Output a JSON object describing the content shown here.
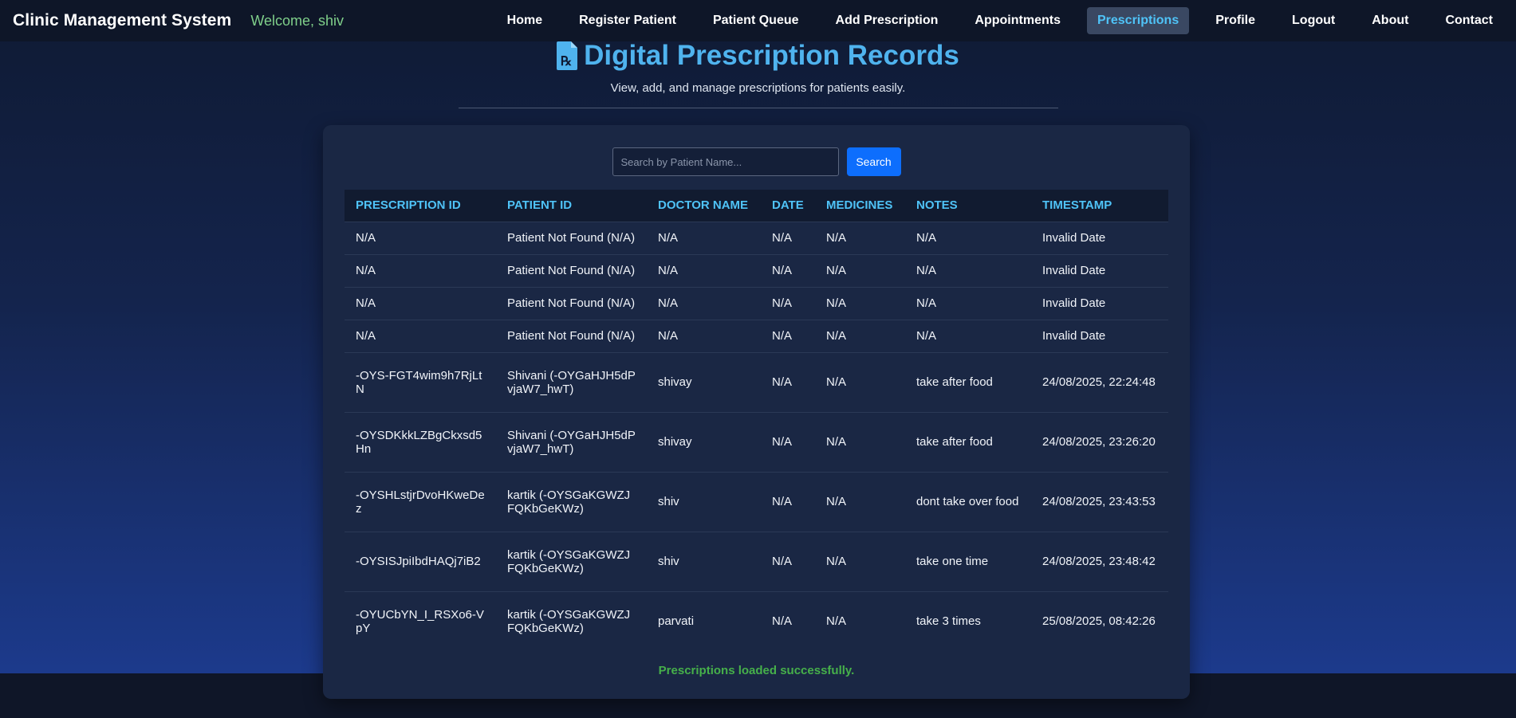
{
  "nav": {
    "brand": "Clinic Management System",
    "welcome": "Welcome, shiv",
    "links": [
      {
        "label": "Home"
      },
      {
        "label": "Register Patient"
      },
      {
        "label": "Patient Queue"
      },
      {
        "label": "Add Prescription"
      },
      {
        "label": "Appointments"
      },
      {
        "label": "Prescriptions",
        "active": true
      },
      {
        "label": "Profile"
      },
      {
        "label": "Logout"
      },
      {
        "label": "About"
      },
      {
        "label": "Contact"
      }
    ]
  },
  "header": {
    "icon": "prescription-icon",
    "title": "Digital Prescription Records",
    "subtitle": "View, add, and manage prescriptions for patients easily."
  },
  "search": {
    "placeholder": "Search by Patient Name...",
    "value": "",
    "button_label": "Search"
  },
  "table": {
    "headers": [
      "PRESCRIPTION ID",
      "PATIENT ID",
      "DOCTOR NAME",
      "DATE",
      "MEDICINES",
      "NOTES",
      "TIMESTAMP"
    ],
    "rows": [
      [
        "N/A",
        "Patient Not Found (N/A)",
        "N/A",
        "N/A",
        "N/A",
        "N/A",
        "Invalid Date"
      ],
      [
        "N/A",
        "Patient Not Found (N/A)",
        "N/A",
        "N/A",
        "N/A",
        "N/A",
        "Invalid Date"
      ],
      [
        "N/A",
        "Patient Not Found (N/A)",
        "N/A",
        "N/A",
        "N/A",
        "N/A",
        "Invalid Date"
      ],
      [
        "N/A",
        "Patient Not Found (N/A)",
        "N/A",
        "N/A",
        "N/A",
        "N/A",
        "Invalid Date"
      ],
      [
        "-OYS-FGT4wim9h7RjLtN",
        "Shivani (-OYGaHJH5dPvjaW7_hwT)",
        "shivay",
        "N/A",
        "N/A",
        "take after food",
        "24/08/2025, 22:24:48"
      ],
      [
        "-OYSDKkkLZBgCkxsd5Hn",
        "Shivani (-OYGaHJH5dPvjaW7_hwT)",
        "shivay",
        "N/A",
        "N/A",
        "take after food",
        "24/08/2025, 23:26:20"
      ],
      [
        "-OYSHLstjrDvoHKweDez",
        "kartik (-OYSGaKGWZJFQKbGeKWz)",
        "shiv",
        "N/A",
        "N/A",
        "dont take over food",
        "24/08/2025, 23:43:53"
      ],
      [
        "-OYSISJpiIbdHAQj7iB2",
        "kartik (-OYSGaKGWZJFQKbGeKWz)",
        "shiv",
        "N/A",
        "N/A",
        "take one time",
        "24/08/2025, 23:48:42"
      ],
      [
        "-OYUCbYN_I_RSXo6-VpY",
        "kartik (-OYSGaKGWZJFQKbGeKWz)",
        "parvati",
        "N/A",
        "N/A",
        "take 3 times",
        "25/08/2025, 08:42:26"
      ]
    ]
  },
  "status_message": "Prescriptions loaded successfully.",
  "colors": {
    "accent": "#4fb3ee",
    "active_link": "#4fc3f7",
    "button": "#0d6efd",
    "success": "#46b04a",
    "welcome": "#7fcf8a"
  }
}
